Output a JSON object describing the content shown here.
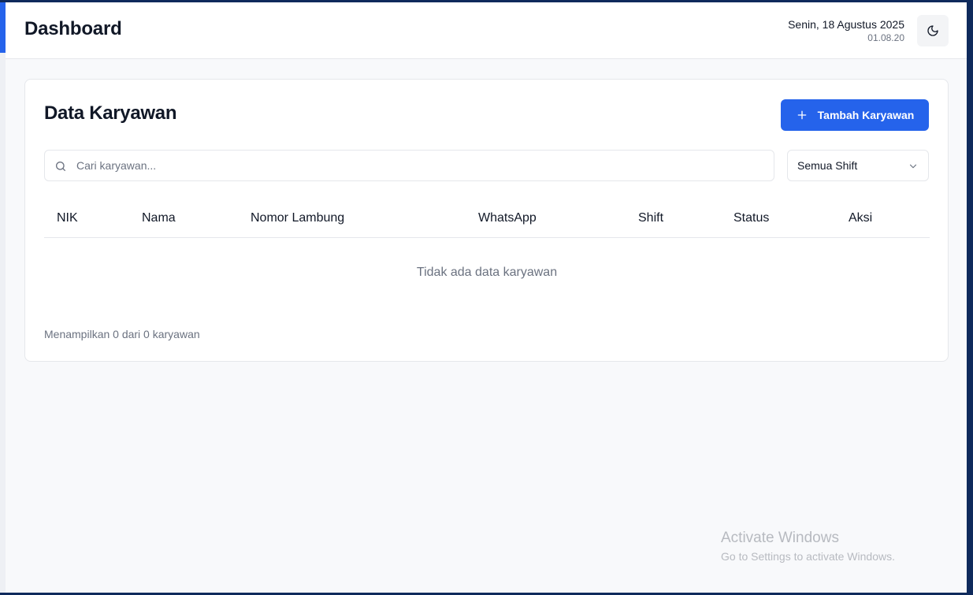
{
  "header": {
    "title": "Dashboard",
    "date": "Senin, 18 Agustus 2025",
    "time": "01.08.20",
    "theme_toggle_icon": "moon-icon"
  },
  "card": {
    "title": "Data Karyawan",
    "add_button_label": "Tambah Karyawan",
    "add_button_icon": "plus-icon",
    "search": {
      "placeholder": "Cari karyawan...",
      "value": ""
    },
    "shift_filter": {
      "selected": "Semua Shift"
    },
    "table": {
      "columns": [
        "NIK",
        "Nama",
        "Nomor Lambung",
        "WhatsApp",
        "Shift",
        "Status",
        "Aksi"
      ],
      "rows": [],
      "empty_message": "Tidak ada data karyawan"
    },
    "footer_text": "Menampilkan 0 dari 0 karyawan"
  },
  "watermark": {
    "title": "Activate Windows",
    "subtitle": "Go to Settings to activate Windows."
  },
  "colors": {
    "primary": "#2563eb",
    "text": "#111827",
    "muted": "#6b7280",
    "border": "#e5e7eb",
    "background": "#f8f9fb"
  }
}
